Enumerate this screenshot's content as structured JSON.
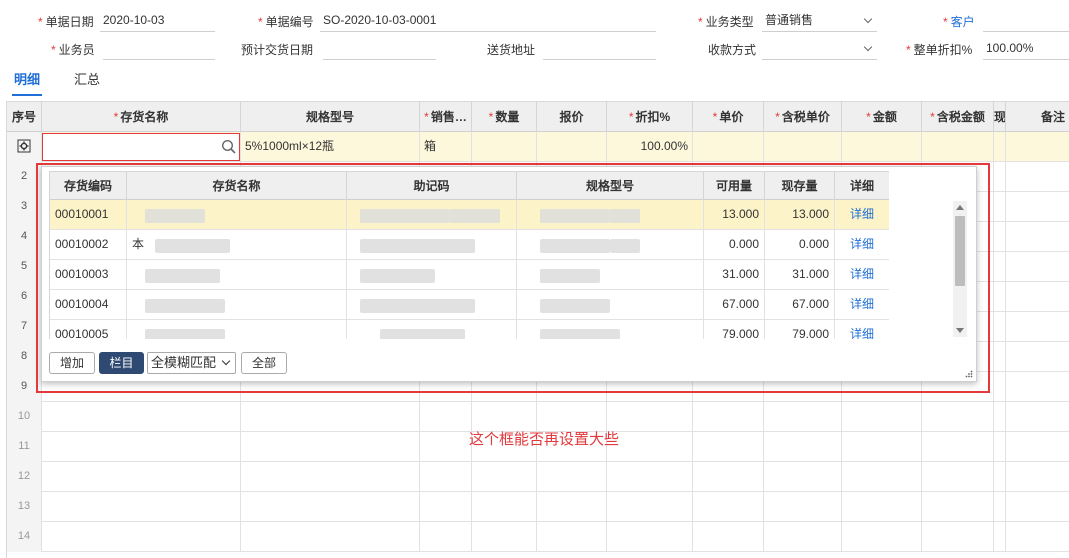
{
  "form": {
    "date_label": "单据日期",
    "date_value": "2020-10-03",
    "number_label": "单据编号",
    "number_value": "SO-2020-10-03-0001",
    "biz_type_label": "业务类型",
    "biz_type_value": "普通销售",
    "customer_label": "客户",
    "salesman_label": "业务员",
    "delivery_date_label": "预计交货日期",
    "address_label": "送货地址",
    "payment_label": "收款方式",
    "discount_label": "整单折扣%",
    "discount_value": "100.00%"
  },
  "tabs": [
    "明细",
    "汇总"
  ],
  "grid": {
    "columns": [
      {
        "label": "序号",
        "required": false
      },
      {
        "label": "存货名称",
        "required": true
      },
      {
        "label": "规格型号",
        "required": false
      },
      {
        "label": "销售…",
        "required": true
      },
      {
        "label": "数量",
        "required": true
      },
      {
        "label": "报价",
        "required": false
      },
      {
        "label": "折扣%",
        "required": true
      },
      {
        "label": "单价",
        "required": true
      },
      {
        "label": "含税单价",
        "required": true
      },
      {
        "label": "金额",
        "required": true
      },
      {
        "label": "含税金额",
        "required": true
      },
      {
        "label": "现",
        "required": false
      },
      {
        "label": "备注",
        "required": false
      }
    ],
    "first_row": {
      "spec": "5%1000ml×12瓶",
      "unit": "箱",
      "discount": "100.00%"
    },
    "row_numbers": [
      "2",
      "3",
      "4",
      "5",
      "6",
      "7",
      "8",
      "9",
      "10",
      "11",
      "12",
      "13",
      "14"
    ]
  },
  "popup": {
    "columns": [
      "存货编码",
      "存货名称",
      "助记码",
      "规格型号",
      "可用量",
      "现存量",
      "详细"
    ],
    "rows": [
      {
        "code": "00010001",
        "name_prefix": "",
        "available": "13.000",
        "stock": "13.000",
        "detail": "详细"
      },
      {
        "code": "00010002",
        "name_prefix": "本",
        "available": "0.000",
        "stock": "0.000",
        "detail": "详细"
      },
      {
        "code": "00010003",
        "name_prefix": "",
        "available": "31.000",
        "stock": "31.000",
        "detail": "详细"
      },
      {
        "code": "00010004",
        "name_prefix": "",
        "available": "67.000",
        "stock": "67.000",
        "detail": "详细"
      },
      {
        "code": "00010005",
        "name_prefix": "",
        "available": "79.000",
        "stock": "79.000",
        "detail": "详细"
      }
    ],
    "buttons": {
      "add": "增加",
      "columns": "栏目",
      "match_mode": "全模糊匹配",
      "all": "全部"
    }
  },
  "annotation": "这个框能否再设置大些",
  "colors": {
    "accent": "#1f6fd6",
    "required": "#e4393c",
    "highlight_row": "#fdf8dc",
    "dark_button": "#2f4a72"
  }
}
